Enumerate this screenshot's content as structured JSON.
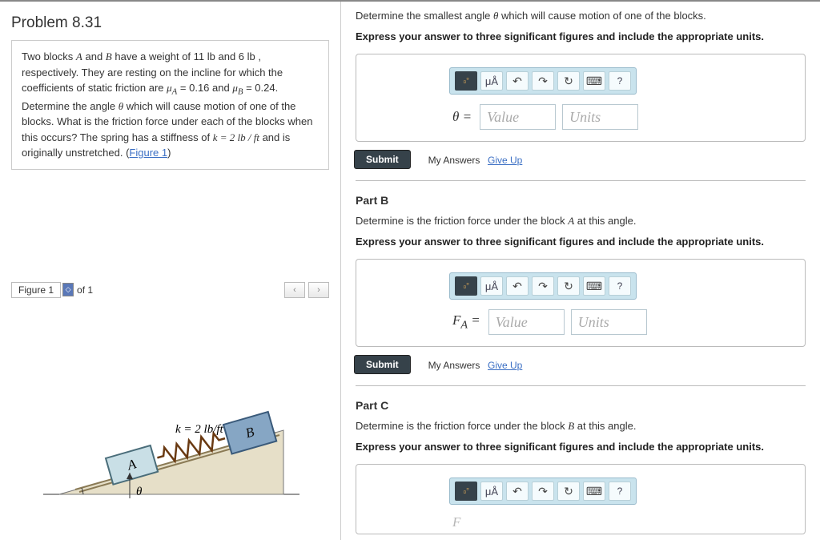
{
  "problem": {
    "title": "Problem 8.31",
    "text_prefix": "Two blocks ",
    "A": "A",
    "and": " and ",
    "B": "B",
    "text_mid1": " have a weight of 11 ",
    "lb1": "lb",
    "text_mid2": " and 6 ",
    "lb2": "lb",
    "text_mid3": " , respectively. They are resting on the incline for which the coefficients of static friction are ",
    "muA": "μ",
    "subA": "A",
    "eqA": " = 0.16 and ",
    "muB": "μ",
    "subB": "B",
    "eqB": " = 0.24. Determine the angle ",
    "theta": "θ",
    "text_mid4": " which will cause motion of one of the blocks. What is the friction force under each of the blocks when this occurs? The spring has a stiffness of ",
    "k_expr": "k = 2 lb / ft",
    "text_end": " and is originally unstretched. (",
    "fig_link": "Figure 1",
    "close": ")"
  },
  "figure_nav": {
    "label": "Figure 1",
    "of": "of 1",
    "prev": "‹",
    "next": "›"
  },
  "figure": {
    "k_label": "k = 2 lb/ft",
    "block_a": "A",
    "block_b": "B",
    "angle": "θ"
  },
  "partA": {
    "question_prefix": "Determine the smallest angle ",
    "theta": "θ",
    "question_suffix": " which will cause motion of one of the blocks.",
    "instruction": "Express your answer to three significant figures and include the appropriate units.",
    "var_label": "θ =",
    "value_ph": "Value",
    "units_ph": "Units"
  },
  "partB": {
    "label": "Part B",
    "question_prefix": "Determine is the friction force under the block ",
    "blk": "A",
    "question_suffix": " at this angle.",
    "instruction": "Express your answer to three significant figures and include the appropriate units.",
    "var_label": "F_A =",
    "value_ph": "Value",
    "units_ph": "Units"
  },
  "partC": {
    "label": "Part C",
    "question_prefix": "Determine is the friction force under the block ",
    "blk": "B",
    "question_suffix": " at this angle.",
    "instruction": "Express your answer to three significant figures and include the appropriate units.",
    "var_label": "F"
  },
  "actions": {
    "submit": "Submit",
    "my_answers": "My Answers",
    "give_up": "Give Up"
  },
  "toolbar": {
    "templates": "▫▫",
    "mu": "μÅ",
    "undo": "↶",
    "redo": "↷",
    "reset": "↻",
    "keyboard": "⌨",
    "help": "?"
  }
}
